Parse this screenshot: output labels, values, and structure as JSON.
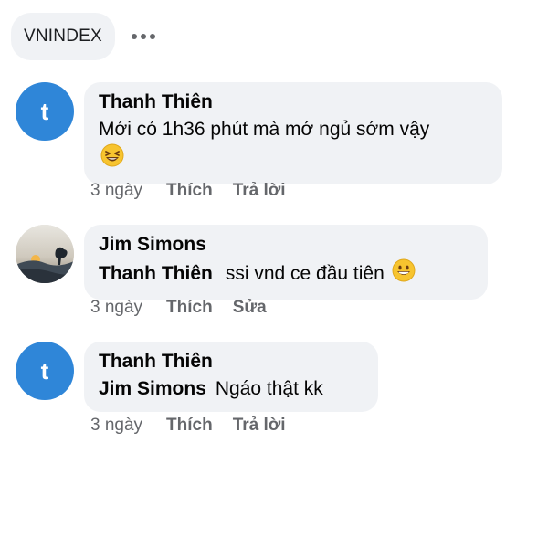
{
  "header": {
    "chip_label": "VNINDEX",
    "more_icon": "more-horizontal-icon"
  },
  "comments": [
    {
      "author": "Thanh Thiên",
      "avatar_letter": "t",
      "avatar_color": "#2f86d8",
      "text": "Mới có 1h36 phút mà mớ ngủ sớm vậy",
      "emoji": "laughing-emoji-icon",
      "time": "3 ngày",
      "like_label": "Thích",
      "action_label": "Trả lời"
    },
    {
      "author": "Jim Simons",
      "avatar_icon": "sunset-photo-avatar",
      "mention": "Thanh Thiên",
      "text": "ssi vnd ce đầu tiên",
      "emoji": "grinning-emoji-icon",
      "time": "3 ngày",
      "like_label": "Thích",
      "action_label": "Sửa"
    },
    {
      "author": "Thanh Thiên",
      "avatar_letter": "t",
      "avatar_color": "#2f86d8",
      "mention": "Jim Simons",
      "text": "Ngáo thật kk",
      "time": "3 ngày",
      "like_label": "Thích",
      "action_label": "Trả lời"
    }
  ],
  "colors": {
    "bubble_bg": "#f0f2f5",
    "meta_text": "#65676b",
    "avatar_blue": "#2f86d8"
  }
}
